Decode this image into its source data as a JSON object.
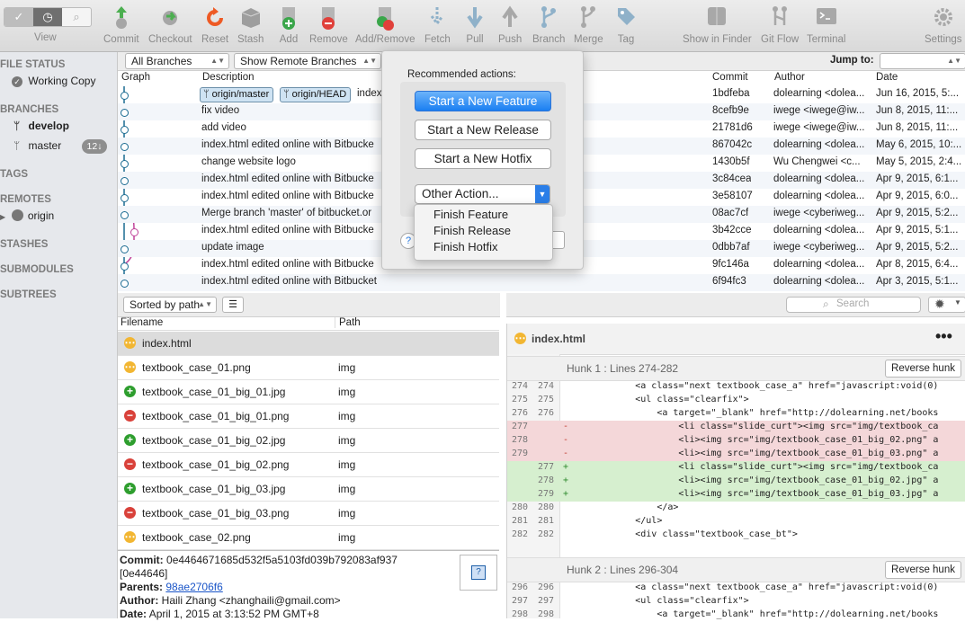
{
  "toolbar": {
    "items": [
      "View",
      "Commit",
      "Checkout",
      "Reset",
      "Stash",
      "Add",
      "Remove",
      "Add/Remove",
      "Fetch",
      "Pull",
      "Push",
      "Branch",
      "Merge",
      "Tag",
      "Show in Finder",
      "Git Flow",
      "Terminal",
      "Settings"
    ]
  },
  "sidebar": {
    "file_status": "FILE STATUS",
    "working_copy": "Working Copy",
    "branches": "BRANCHES",
    "develop": "develop",
    "master": "master",
    "master_badge": "12↓",
    "tags": "TAGS",
    "remotes": "REMOTES",
    "origin": "origin",
    "stashes": "STASHES",
    "submodules": "SUBMODULES",
    "subtrees": "SUBTREES"
  },
  "filter": {
    "branches": "All Branches",
    "remote": "Show Remote Branches",
    "jump_label": "Jump to:"
  },
  "columns": {
    "graph": "Graph",
    "description": "Description",
    "commit": "Commit",
    "author": "Author",
    "date": "Date"
  },
  "commits": [
    {
      "tags": [
        "origin/master",
        "origin/HEAD"
      ],
      "desc": "index",
      "hash": "1bdfeba",
      "author": "dolearning <dolea...",
      "date": "Jun 16, 2015, 5:..."
    },
    {
      "desc": "fix video",
      "hash": "8cefb9e",
      "author": "iwege <iwege@iw...",
      "date": "Jun 8, 2015, 11:..."
    },
    {
      "desc": "add video",
      "hash": "21781d6",
      "author": "iwege <iwege@iw...",
      "date": "Jun 8, 2015, 11:..."
    },
    {
      "desc": "index.html edited online with Bitbucke",
      "hash": "867042c",
      "author": "dolearning <dolea...",
      "date": "May 6, 2015, 10:..."
    },
    {
      "desc": "change website logo",
      "hash": "1430b5f",
      "author": "Wu Chengwei <c...",
      "date": "May 5, 2015, 2:4..."
    },
    {
      "desc": "index.html edited online with Bitbucke",
      "hash": "3c84cea",
      "author": "dolearning <dolea...",
      "date": "Apr 9, 2015, 6:1..."
    },
    {
      "desc": "index.html edited online with Bitbucke",
      "hash": "3e58107",
      "author": "dolearning <dolea...",
      "date": "Apr 9, 2015, 6:0..."
    },
    {
      "desc": "Merge branch 'master' of bitbucket.or",
      "hash": "08ac7cf",
      "author": "iwege <cyberiweg...",
      "date": "Apr 9, 2015, 5:2..."
    },
    {
      "desc": "index.html edited online with Bitbucke",
      "hash": "3b42cce",
      "author": "dolearning <dolea...",
      "date": "Apr 9, 2015, 5:1..."
    },
    {
      "desc": "update image",
      "hash": "0dbb7af",
      "author": "iwege <cyberiweg...",
      "date": "Apr 9, 2015, 5:2..."
    },
    {
      "desc": "index.html edited online with Bitbucke",
      "hash": "9fc146a",
      "author": "dolearning <dolea...",
      "date": "Apr 8, 2015, 6:4..."
    },
    {
      "desc": "index.html edited online with Bitbucket",
      "hash": "6f94fc3",
      "author": "dolearning <dolea...",
      "date": "Apr 3, 2015, 5:1..."
    }
  ],
  "popover": {
    "title": "Recommended actions:",
    "buttons": [
      "Start a New Feature",
      "Start a New Release",
      "Start a New Hotfix"
    ],
    "other": "Other Action...",
    "help": "?",
    "menu": [
      "Finish Feature",
      "Finish Release",
      "Finish Hotfix"
    ]
  },
  "files": {
    "sort": "Sorted by path",
    "col_filename": "Filename",
    "col_path": "Path",
    "search_placeholder": "Search",
    "rows": [
      {
        "status": "modified",
        "name": "index.html",
        "path": ""
      },
      {
        "status": "modified",
        "name": "textbook_case_01.png",
        "path": "img"
      },
      {
        "status": "added",
        "name": "textbook_case_01_big_01.jpg",
        "path": "img"
      },
      {
        "status": "removed",
        "name": "textbook_case_01_big_01.png",
        "path": "img"
      },
      {
        "status": "added",
        "name": "textbook_case_01_big_02.jpg",
        "path": "img"
      },
      {
        "status": "removed",
        "name": "textbook_case_01_big_02.png",
        "path": "img"
      },
      {
        "status": "added",
        "name": "textbook_case_01_big_03.jpg",
        "path": "img"
      },
      {
        "status": "removed",
        "name": "textbook_case_01_big_03.png",
        "path": "img"
      },
      {
        "status": "modified",
        "name": "textbook_case_02.png",
        "path": "img"
      }
    ]
  },
  "commit_info": {
    "commit_label": "Commit:",
    "commit_hash": "0e4464671685d532f5a5103fd039b792083af937",
    "short": "[0e44646]",
    "parents_label": "Parents:",
    "parents": "98ae2706f6",
    "author_label": "Author:",
    "author": "Haili Zhang <zhanghaili@gmail.com>",
    "date_label": "Date:",
    "date": "April 1, 2015 at 3:13:52 PM GMT+8"
  },
  "diff": {
    "file": "index.html",
    "hunk1": "Hunk 1 : Lines 274-282",
    "hunk2": "Hunk 2 : Lines 296-304",
    "reverse": "Reverse hunk",
    "lines1": [
      {
        "t": "ctx",
        "a": "274",
        "b": "274",
        "s": "",
        "x": "            <a class=\"next textbook_case_a\" href=\"javascript:void(0)"
      },
      {
        "t": "ctx",
        "a": "275",
        "b": "275",
        "s": "",
        "x": "            <ul class=\"clearfix\">"
      },
      {
        "t": "ctx",
        "a": "276",
        "b": "276",
        "s": "",
        "x": "                <a target=\"_blank\" href=\"http://dolearning.net/books"
      },
      {
        "t": "del",
        "a": "277",
        "b": "",
        "s": "-",
        "x": "                    <li class=\"slide_curt\"><img src=\"img/textbook_ca"
      },
      {
        "t": "del",
        "a": "278",
        "b": "",
        "s": "-",
        "x": "                    <li><img src=\"img/textbook_case_01_big_02.png\" a"
      },
      {
        "t": "del",
        "a": "279",
        "b": "",
        "s": "-",
        "x": "                    <li><img src=\"img/textbook_case_01_big_03.png\" a"
      },
      {
        "t": "add",
        "a": "",
        "b": "277",
        "s": "+",
        "x": "                    <li class=\"slide_curt\"><img src=\"img/textbook_ca"
      },
      {
        "t": "add",
        "a": "",
        "b": "278",
        "s": "+",
        "x": "                    <li><img src=\"img/textbook_case_01_big_02.jpg\" a"
      },
      {
        "t": "add",
        "a": "",
        "b": "279",
        "s": "+",
        "x": "                    <li><img src=\"img/textbook_case_01_big_03.jpg\" a"
      },
      {
        "t": "ctx",
        "a": "280",
        "b": "280",
        "s": "",
        "x": "                </a>"
      },
      {
        "t": "ctx",
        "a": "281",
        "b": "281",
        "s": "",
        "x": "            </ul>"
      },
      {
        "t": "ctx",
        "a": "282",
        "b": "282",
        "s": "",
        "x": "            <div class=\"textbook_case_bt\">"
      }
    ],
    "lines2": [
      {
        "t": "ctx",
        "a": "296",
        "b": "296",
        "s": "",
        "x": "            <a class=\"next textbook_case_a\" href=\"javascript:void(0)"
      },
      {
        "t": "ctx",
        "a": "297",
        "b": "297",
        "s": "",
        "x": "            <ul class=\"clearfix\">"
      },
      {
        "t": "ctx",
        "a": "298",
        "b": "298",
        "s": "",
        "x": "                <a target=\"_blank\" href=\"http://dolearning.net/books"
      }
    ]
  },
  "colors": {
    "accent": "#1a7ff2",
    "added": "#2e9e2e",
    "removed": "#d9413a",
    "modified": "#f2b632",
    "graph": "#1c6c92",
    "merge": "#c0449a"
  }
}
